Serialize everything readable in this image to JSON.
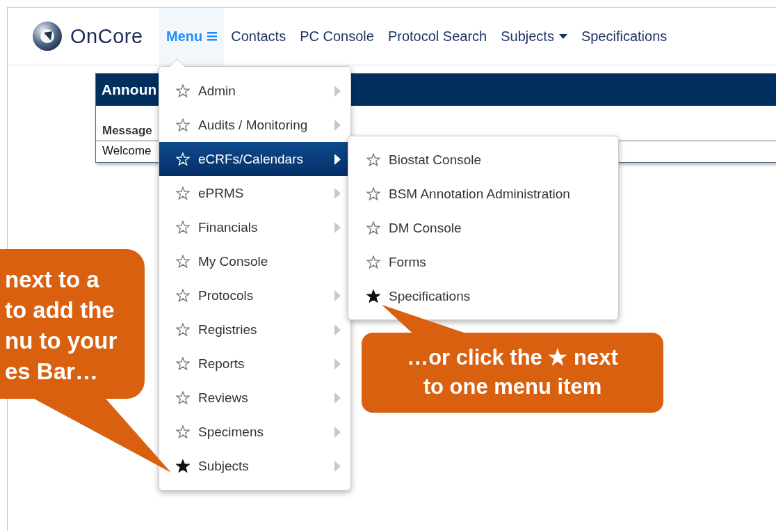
{
  "logo": {
    "text": "OnCore"
  },
  "nav": [
    {
      "label": "Menu",
      "kind": "menu",
      "open": true
    },
    {
      "label": "Contacts",
      "kind": "link"
    },
    {
      "label": "PC Console",
      "kind": "link"
    },
    {
      "label": "Protocol Search",
      "kind": "link"
    },
    {
      "label": "Subjects",
      "kind": "dropdown"
    },
    {
      "label": "Specifications",
      "kind": "link"
    }
  ],
  "announcements": {
    "title": "Announ",
    "column": "Message",
    "row": "Welcome"
  },
  "menu": [
    {
      "label": "Admin",
      "favorite": false,
      "submenu": true,
      "selected": false
    },
    {
      "label": "Audits / Monitoring",
      "favorite": false,
      "submenu": true,
      "selected": false
    },
    {
      "label": "eCRFs/Calendars",
      "favorite": false,
      "submenu": true,
      "selected": true
    },
    {
      "label": "ePRMS",
      "favorite": false,
      "submenu": true,
      "selected": false
    },
    {
      "label": "Financials",
      "favorite": false,
      "submenu": true,
      "selected": false
    },
    {
      "label": "My Console",
      "favorite": false,
      "submenu": false,
      "selected": false
    },
    {
      "label": "Protocols",
      "favorite": false,
      "submenu": true,
      "selected": false
    },
    {
      "label": "Registries",
      "favorite": false,
      "submenu": true,
      "selected": false
    },
    {
      "label": "Reports",
      "favorite": false,
      "submenu": true,
      "selected": false
    },
    {
      "label": "Reviews",
      "favorite": false,
      "submenu": true,
      "selected": false
    },
    {
      "label": "Specimens",
      "favorite": false,
      "submenu": true,
      "selected": false
    },
    {
      "label": "Subjects",
      "favorite": true,
      "submenu": true,
      "selected": false
    }
  ],
  "submenu": [
    {
      "label": "Biostat Console",
      "favorite": false
    },
    {
      "label": "BSM Annotation Administration",
      "favorite": false
    },
    {
      "label": "DM Console",
      "favorite": false
    },
    {
      "label": "Forms",
      "favorite": false
    },
    {
      "label": "Specifications",
      "favorite": true
    }
  ],
  "callouts": [
    {
      "kind": "left",
      "lines": [
        "next to a",
        "to add the",
        "nu to your",
        "es Bar…"
      ]
    },
    {
      "kind": "right",
      "lines": [
        "…or click the ★ next",
        "to one menu item"
      ]
    }
  ]
}
